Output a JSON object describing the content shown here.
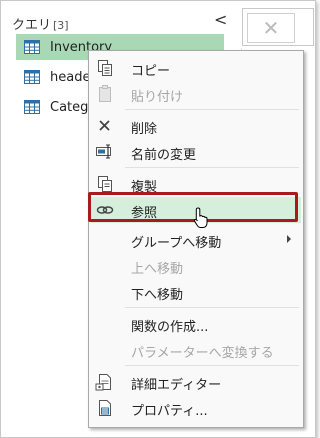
{
  "queries": {
    "header": "クエリ",
    "count": "[3]",
    "collapse_glyph": "<",
    "items": [
      {
        "label": "Inventory",
        "selected": true
      },
      {
        "label": "heade"
      },
      {
        "label": "Categ"
      }
    ]
  },
  "context_menu": {
    "items": [
      {
        "label": "コピー",
        "icon": "copy-icon",
        "enabled": true
      },
      {
        "label": "貼り付け",
        "icon": "paste-icon",
        "enabled": false
      },
      {
        "label": "削除",
        "icon": "delete-icon",
        "enabled": true
      },
      {
        "label": "名前の変更",
        "icon": "rename-icon",
        "enabled": true
      },
      {
        "label": "複製",
        "icon": "duplicate-icon",
        "enabled": true
      },
      {
        "label": "参照",
        "icon": "reference-icon",
        "enabled": true,
        "highlighted": true
      },
      {
        "label": "グループへ移動",
        "enabled": true,
        "submenu": true
      },
      {
        "label": "上へ移動",
        "enabled": false
      },
      {
        "label": "下へ移動",
        "enabled": true
      },
      {
        "label": "関数の作成...",
        "enabled": true
      },
      {
        "label": "パラメーターへ変換する",
        "enabled": false
      },
      {
        "label": "詳細エディター",
        "icon": "advanced-editor-icon",
        "enabled": true
      },
      {
        "label": "プロパティ...",
        "icon": "properties-icon",
        "enabled": true
      }
    ]
  },
  "colors": {
    "selected_query_bg": "#a9d8b4",
    "highlight_bg": "#d6efdc",
    "annotation_border": "#a91b1b"
  }
}
